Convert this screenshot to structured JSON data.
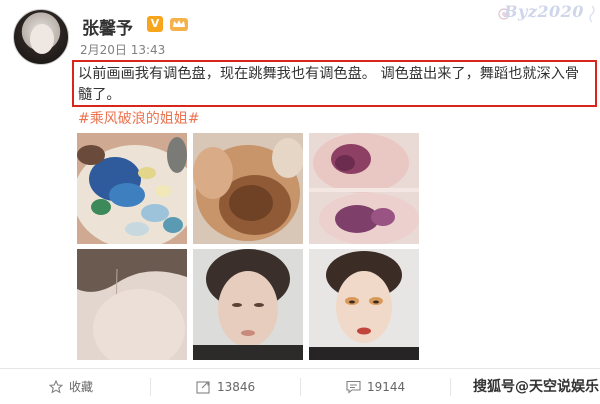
{
  "post": {
    "author": "张馨予",
    "verified_badge": "V",
    "time": "2月20日 13:43",
    "text_line1": "以前画画我有调色盘，现在跳舞我也有调色盘。 调色盘出来了，舞蹈也就深入骨",
    "text_line2": "髓了。",
    "hashtag": "#乘风破浪的姐姐#"
  },
  "watermark_top": "Byz2020",
  "actions": {
    "favorite_label": "收藏",
    "repost_count": "13846",
    "comment_count": "19144"
  },
  "watermark_bottom": "搜狐号@天空说娱乐",
  "colors": {
    "highlight_border": "#d9261c",
    "hashtag": "#eb7350",
    "badge": "#f7a51c"
  },
  "photos": [
    {
      "description": "palette-icon-image"
    },
    {
      "description": "bruised-elbow-image"
    },
    {
      "description": "bruised-knees-image"
    },
    {
      "description": "forehead-image"
    },
    {
      "description": "face-image"
    },
    {
      "description": "makeup-portrait-image"
    }
  ]
}
